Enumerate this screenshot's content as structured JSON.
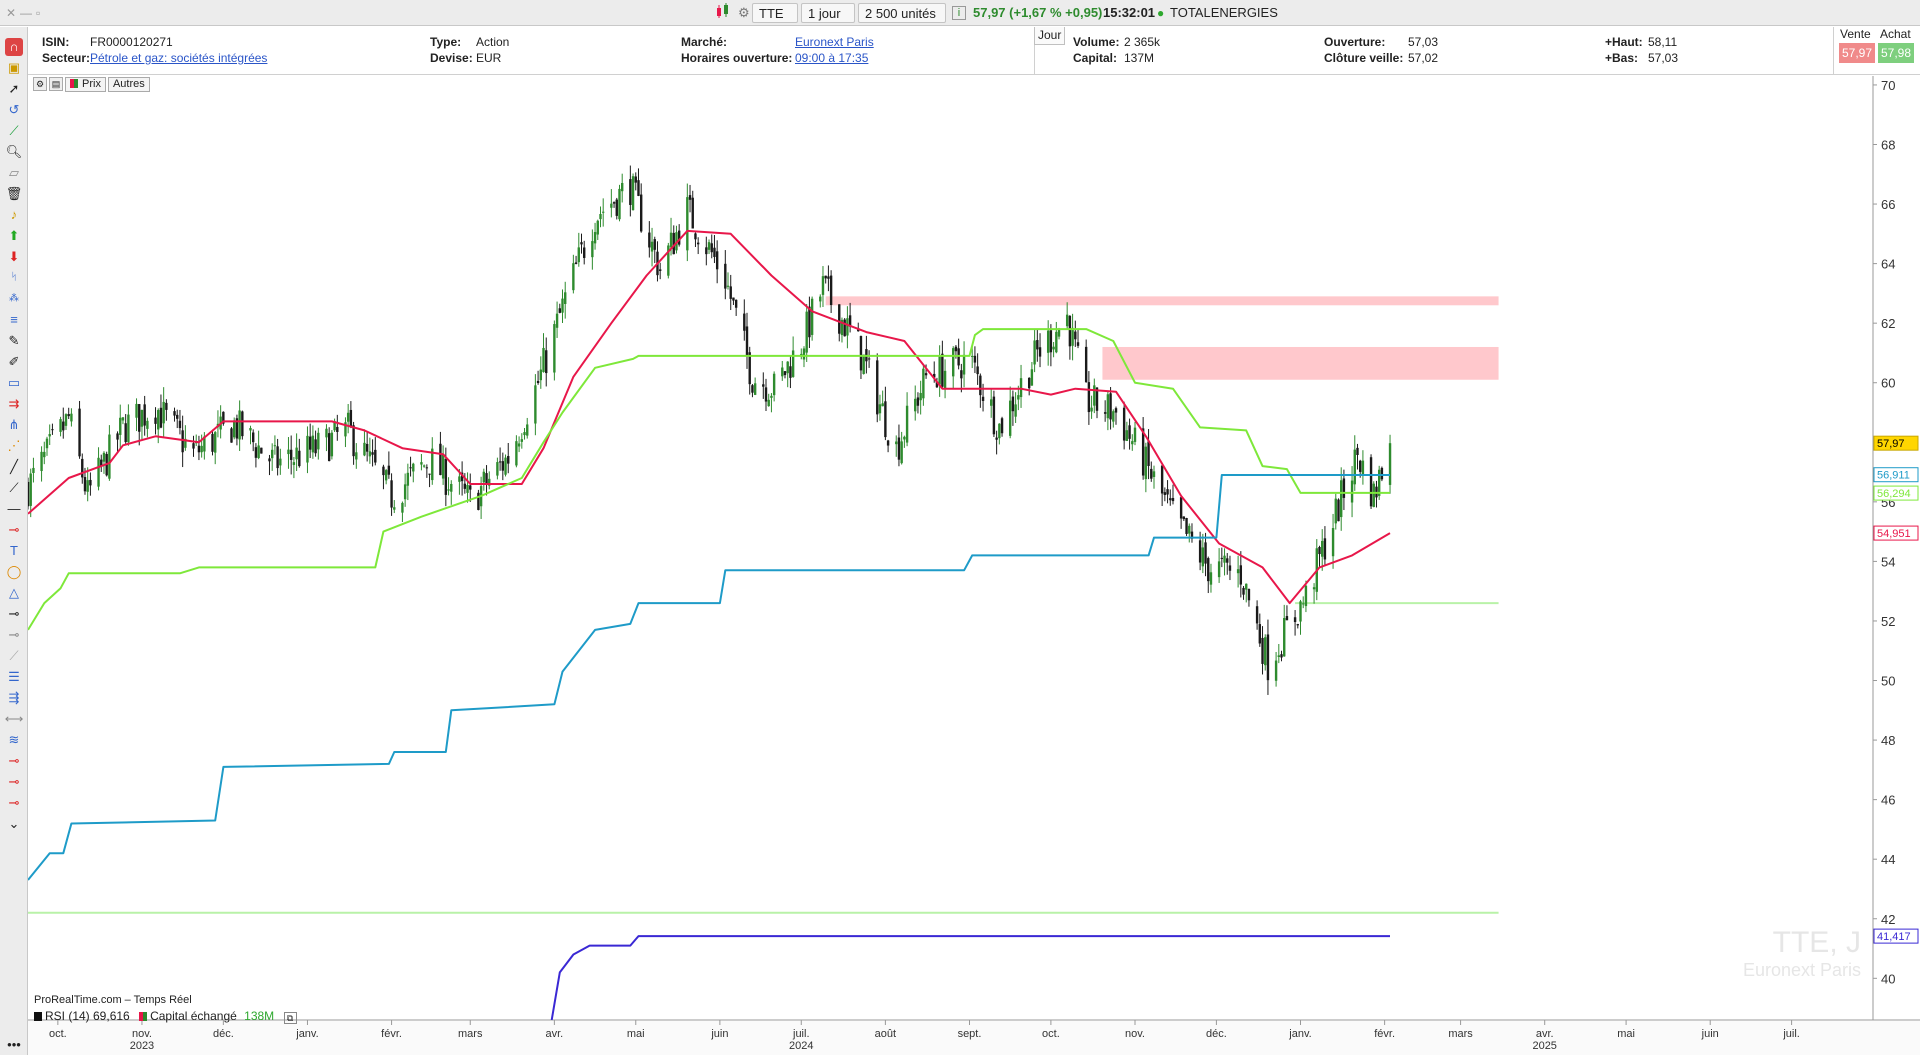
{
  "topbar": {
    "ticker": "TTE",
    "period": "1 jour",
    "units": "2 500 unités",
    "quote": "57,97 (+1,67 % +0,95)",
    "time": "15:32:01",
    "name": "TOTALENERGIES"
  },
  "info": {
    "isin_label": "ISIN:",
    "isin": "FR0000120271",
    "sector_label": "Secteur:",
    "sector": "Pétrole et gaz: sociétés intégrées",
    "type_label": "Type:",
    "type": "Action",
    "currency_label": "Devise:",
    "currency": "EUR",
    "market_label": "Marché:",
    "market": "Euronext Paris",
    "hours_label": "Horaires ouverture:",
    "hours": "09:00 à 17:35",
    "day_tab": "Jour",
    "volume_label": "Volume:",
    "volume": "2 365k",
    "capital_label": "Capital:",
    "capital": "137M",
    "open_label": "Ouverture:",
    "open": "57,03",
    "prev_close_label": "Clôture veille:",
    "prev_close": "57,02",
    "high_label": "+Haut:",
    "high": "58,11",
    "low_label": "+Bas:",
    "low": "57,03",
    "sell_label": "Vente",
    "sell": "57,97",
    "buy_label": "Achat",
    "buy": "57,98"
  },
  "chart_panel": {
    "tab_price": "Prix",
    "tab_others": "Autres",
    "source": "ProRealTime.com – Temps Réel",
    "watermark_symbol": "TTE, J",
    "watermark_market": "Euronext Paris",
    "rsi_legend": "RSI (14) 69,616",
    "capital_legend": "Capital échangé",
    "capital_legend_value": "138M"
  },
  "colors": {
    "up": "#2e8b2e",
    "down": "#1a1a1a",
    "red_line": "#e8174a",
    "green_line": "#7ee83a",
    "blue_line": "#1e9bc8",
    "purple_line": "#3a28d4",
    "zone": "#ffc8cc",
    "sell_bg": "#f08a8a",
    "buy_bg": "#7ecf7e"
  },
  "chart_data": {
    "type": "candlestick",
    "y_axis": {
      "min": 38.6,
      "max": 70.3,
      "ticks": [
        40,
        42,
        44,
        46,
        48,
        50,
        52,
        54,
        56,
        58,
        60,
        62,
        64,
        66,
        68,
        70
      ]
    },
    "x_axis": {
      "start": "2023-09-20",
      "end": "2025-07-31",
      "months": [
        {
          "label": "oct.",
          "date": "2023-10-01"
        },
        {
          "label": "nov.",
          "date": "2023-11-01"
        },
        {
          "label": "déc.",
          "date": "2023-12-01"
        },
        {
          "label": "janv.",
          "date": "2024-01-01"
        },
        {
          "label": "févr.",
          "date": "2024-02-01"
        },
        {
          "label": "mars",
          "date": "2024-03-01"
        },
        {
          "label": "avr.",
          "date": "2024-04-01"
        },
        {
          "label": "mai",
          "date": "2024-05-01"
        },
        {
          "label": "juin",
          "date": "2024-06-01"
        },
        {
          "label": "juil.",
          "date": "2024-07-01"
        },
        {
          "label": "août",
          "date": "2024-08-01"
        },
        {
          "label": "sept.",
          "date": "2024-09-01"
        },
        {
          "label": "oct.",
          "date": "2024-10-01"
        },
        {
          "label": "nov.",
          "date": "2024-11-01"
        },
        {
          "label": "déc.",
          "date": "2024-12-01"
        },
        {
          "label": "janv.",
          "date": "2025-01-01"
        },
        {
          "label": "févr.",
          "date": "2025-02-01"
        },
        {
          "label": "mars",
          "date": "2025-03-01"
        },
        {
          "label": "avr.",
          "date": "2025-04-01"
        },
        {
          "label": "mai",
          "date": "2025-05-01"
        },
        {
          "label": "juin",
          "date": "2025-06-01"
        },
        {
          "label": "juil.",
          "date": "2025-07-01"
        }
      ],
      "years": [
        {
          "label": "2023",
          "date": "2023-11-01"
        },
        {
          "label": "2024",
          "date": "2024-07-01"
        },
        {
          "label": "2025",
          "date": "2025-04-01"
        }
      ]
    },
    "price_path": [
      [
        "2023-09-20",
        56.5
      ],
      [
        "2023-10-05",
        58.8
      ],
      [
        "2023-10-12",
        56.2
      ],
      [
        "2023-10-25",
        58.5
      ],
      [
        "2023-11-06",
        59.2
      ],
      [
        "2023-11-20",
        57.6
      ],
      [
        "2023-12-05",
        58.6
      ],
      [
        "2023-12-20",
        57.3
      ],
      [
        "2024-01-05",
        57.8
      ],
      [
        "2024-01-16",
        58.4
      ],
      [
        "2024-02-01",
        56.2
      ],
      [
        "2024-02-15",
        57.4
      ],
      [
        "2024-03-01",
        56.0
      ],
      [
        "2024-03-15",
        57.5
      ],
      [
        "2024-03-26",
        60.0
      ],
      [
        "2024-04-05",
        62.8
      ],
      [
        "2024-04-16",
        65.6
      ],
      [
        "2024-04-29",
        66.6
      ],
      [
        "2024-05-10",
        63.8
      ],
      [
        "2024-05-20",
        65.8
      ],
      [
        "2024-06-03",
        63.5
      ],
      [
        "2024-06-13",
        60.2
      ],
      [
        "2024-06-21",
        59.8
      ],
      [
        "2024-07-01",
        61.3
      ],
      [
        "2024-07-09",
        63.2
      ],
      [
        "2024-07-22",
        61.2
      ],
      [
        "2024-08-05",
        57.8
      ],
      [
        "2024-08-16",
        60.2
      ],
      [
        "2024-09-01",
        60.8
      ],
      [
        "2024-09-12",
        58.5
      ],
      [
        "2024-09-26",
        61.0
      ],
      [
        "2024-10-07",
        62.2
      ],
      [
        "2024-10-14",
        59.4
      ],
      [
        "2024-10-25",
        59.0
      ],
      [
        "2024-11-04",
        57.4
      ],
      [
        "2024-11-15",
        55.5
      ],
      [
        "2024-11-28",
        53.8
      ],
      [
        "2024-12-10",
        53.6
      ],
      [
        "2024-12-20",
        50.6
      ],
      [
        "2025-01-03",
        52.8
      ],
      [
        "2025-01-14",
        55.6
      ],
      [
        "2025-01-22",
        57.6
      ],
      [
        "2025-01-28",
        56.2
      ],
      [
        "2025-02-03",
        57.97
      ]
    ],
    "series": [
      {
        "color": "red",
        "points": [
          [
            "2023-09-20",
            55.6
          ],
          [
            "2023-10-05",
            56.8
          ],
          [
            "2023-10-20",
            57.3
          ],
          [
            "2023-10-25",
            57.9
          ],
          [
            "2023-11-06",
            58.2
          ],
          [
            "2023-11-22",
            58.0
          ],
          [
            "2023-12-01",
            58.7
          ],
          [
            "2024-01-10",
            58.7
          ],
          [
            "2024-01-22",
            58.4
          ],
          [
            "2024-02-05",
            57.8
          ],
          [
            "2024-02-20",
            57.6
          ],
          [
            "2024-03-01",
            56.6
          ],
          [
            "2024-03-20",
            56.6
          ],
          [
            "2024-03-28",
            57.8
          ],
          [
            "2024-04-08",
            60.2
          ],
          [
            "2024-04-22",
            62.0
          ],
          [
            "2024-05-05",
            63.6
          ],
          [
            "2024-05-20",
            65.1
          ],
          [
            "2024-06-05",
            65.0
          ],
          [
            "2024-06-20",
            63.6
          ],
          [
            "2024-07-05",
            62.4
          ],
          [
            "2024-07-25",
            61.7
          ],
          [
            "2024-08-08",
            61.4
          ],
          [
            "2024-08-22",
            59.8
          ],
          [
            "2024-09-05",
            59.8
          ],
          [
            "2024-09-20",
            59.8
          ],
          [
            "2024-10-01",
            59.6
          ],
          [
            "2024-10-10",
            59.8
          ],
          [
            "2024-10-25",
            59.7
          ],
          [
            "2024-11-05",
            58.2
          ],
          [
            "2024-11-18",
            56.2
          ],
          [
            "2024-12-02",
            54.6
          ],
          [
            "2024-12-18",
            53.8
          ],
          [
            "2024-12-28",
            52.6
          ],
          [
            "2025-01-08",
            53.8
          ],
          [
            "2025-01-20",
            54.2
          ],
          [
            "2025-02-03",
            54.95
          ]
        ]
      },
      {
        "color": "green",
        "points": [
          [
            "2023-09-20",
            51.7
          ],
          [
            "2023-09-26",
            52.6
          ],
          [
            "2023-10-02",
            53.1
          ],
          [
            "2023-10-05",
            53.6
          ],
          [
            "2023-11-15",
            53.6
          ],
          [
            "2023-11-22",
            53.8
          ],
          [
            "2024-01-26",
            53.8
          ],
          [
            "2024-01-29",
            55.0
          ],
          [
            "2024-02-12",
            55.5
          ],
          [
            "2024-03-05",
            56.2
          ],
          [
            "2024-03-20",
            56.8
          ],
          [
            "2024-03-28",
            58.0
          ],
          [
            "2024-04-04",
            59.0
          ],
          [
            "2024-04-16",
            60.5
          ],
          [
            "2024-04-30",
            60.8
          ],
          [
            "2024-05-02",
            60.9
          ],
          [
            "2024-09-01",
            60.9
          ],
          [
            "2024-09-03",
            61.6
          ],
          [
            "2024-09-06",
            61.8
          ],
          [
            "2024-10-14",
            61.8
          ],
          [
            "2024-10-24",
            61.4
          ],
          [
            "2024-11-01",
            60.0
          ],
          [
            "2024-11-15",
            59.8
          ],
          [
            "2024-11-25",
            58.5
          ],
          [
            "2024-12-12",
            58.4
          ],
          [
            "2024-12-18",
            57.2
          ],
          [
            "2024-12-27",
            57.1
          ],
          [
            "2025-01-01",
            56.3
          ],
          [
            "2025-02-03",
            56.3
          ]
        ]
      },
      {
        "color": "blue",
        "points": [
          [
            "2023-09-20",
            43.3
          ],
          [
            "2023-09-28",
            44.2
          ],
          [
            "2023-10-03",
            44.2
          ],
          [
            "2023-10-06",
            45.2
          ],
          [
            "2023-11-28",
            45.3
          ],
          [
            "2023-12-01",
            47.1
          ],
          [
            "2024-01-31",
            47.2
          ],
          [
            "2024-02-02",
            47.6
          ],
          [
            "2024-02-21",
            47.6
          ],
          [
            "2024-02-23",
            49.0
          ],
          [
            "2024-04-01",
            49.2
          ],
          [
            "2024-04-04",
            50.3
          ],
          [
            "2024-04-16",
            51.7
          ],
          [
            "2024-04-29",
            51.9
          ],
          [
            "2024-05-02",
            52.6
          ],
          [
            "2024-06-01",
            52.6
          ],
          [
            "2024-06-03",
            53.7
          ],
          [
            "2024-08-30",
            53.7
          ],
          [
            "2024-09-02",
            54.2
          ],
          [
            "2024-11-06",
            54.2
          ],
          [
            "2024-11-08",
            54.8
          ],
          [
            "2024-12-01",
            54.8
          ],
          [
            "2024-12-03",
            56.9
          ],
          [
            "2025-02-03",
            56.9
          ]
        ]
      },
      {
        "color": "purple",
        "points": [
          [
            "2024-03-31",
            38.6
          ],
          [
            "2024-04-03",
            40.2
          ],
          [
            "2024-04-08",
            40.8
          ],
          [
            "2024-04-14",
            41.1
          ],
          [
            "2024-04-29",
            41.1
          ],
          [
            "2024-05-02",
            41.417
          ],
          [
            "2025-02-03",
            41.417
          ]
        ]
      }
    ],
    "horizontal_levels": [
      {
        "value": 52.6,
        "from": "2024-12-30",
        "to": "2025-03-15",
        "color": "light-green"
      },
      {
        "value": 42.2,
        "from": "2023-09-20",
        "to": "2025-03-15",
        "color": "light-green"
      }
    ],
    "zones": [
      {
        "from": "2024-07-10",
        "to": "2025-03-15",
        "low": 62.6,
        "high": 62.9
      },
      {
        "from": "2024-10-20",
        "to": "2025-03-15",
        "low": 60.1,
        "high": 61.2
      }
    ],
    "price_labels": [
      {
        "value": "57,97",
        "y": 57.97,
        "style": "last"
      },
      {
        "value": "56,911",
        "y": 56.911,
        "style": "blue"
      },
      {
        "value": "56,294",
        "y": 56.294,
        "style": "green"
      },
      {
        "value": "54,951",
        "y": 54.951,
        "style": "red"
      },
      {
        "value": "41,417",
        "y": 41.417,
        "style": "purple"
      }
    ]
  }
}
